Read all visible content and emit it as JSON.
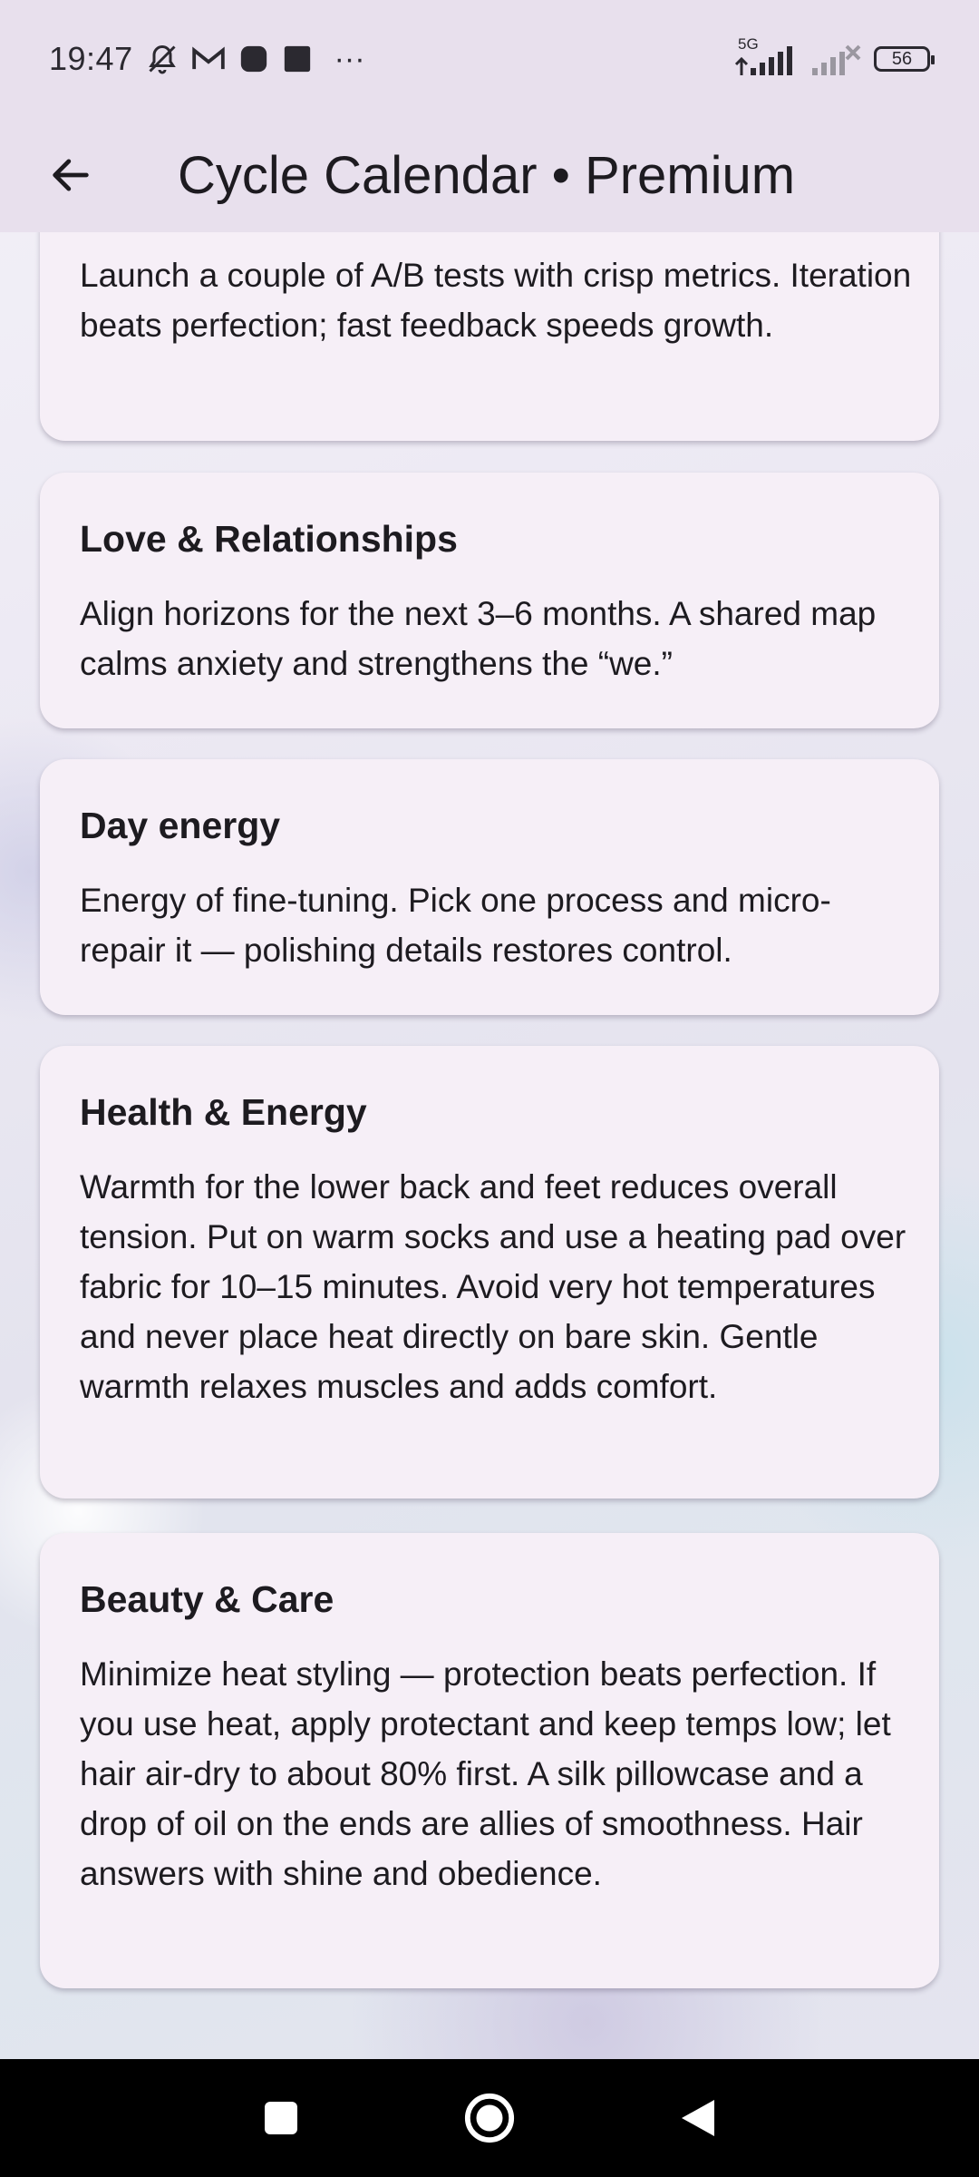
{
  "status": {
    "time": "19:47",
    "network": "5G",
    "battery": "56",
    "more": "···"
  },
  "app_bar": {
    "title": "Cycle Calendar • Premium"
  },
  "cards": [
    {
      "title": "",
      "body": "Launch a couple of A/B tests with crisp metrics. Iteration beats perfection; fast feedback speeds growth."
    },
    {
      "title": "Love & Relationships",
      "body": "Align horizons for the next 3–6 months. A shared map calms anxiety and strengthens the “we.”"
    },
    {
      "title": "Day energy",
      "body": "Energy of fine-tuning. Pick one process and micro-repair it — polishing details restores control."
    },
    {
      "title": "Health & Energy",
      "body": "Warmth for the lower back and feet reduces overall tension. Put on warm socks and use a heating pad over fabric for 10–15 minutes. Avoid very hot temperatures and never place heat directly on bare skin. Gentle warmth relaxes muscles and adds comfort."
    },
    {
      "title": "Beauty & Care",
      "body": "Minimize heat styling — protection beats perfection. If you use heat, apply protectant and keep temps low; let hair air-dry to about 80% first. A silk pillowcase and a drop of oil on the ends are allies of smoothness. Hair answers with shine and obedience."
    }
  ],
  "icons": {
    "back": "arrow-left-icon",
    "nav_recent": "square-icon",
    "nav_home": "circle-icon",
    "nav_back": "triangle-back-icon"
  },
  "colors": {
    "card_bg": "#f6eff7",
    "app_bar_bg": "#e8e0ed",
    "text": "#1d1b20"
  }
}
